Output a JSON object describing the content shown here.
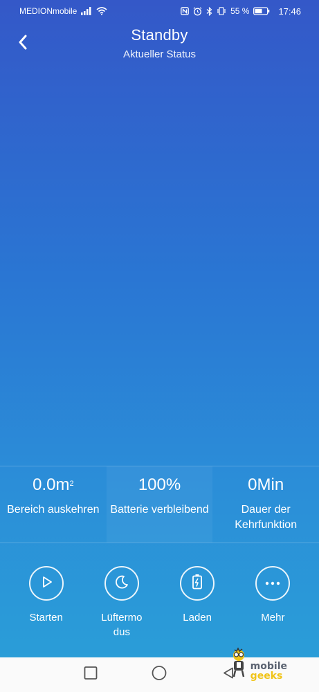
{
  "status_bar": {
    "carrier": "MEDIONmobile",
    "battery_percent": "55 %",
    "time": "17:46",
    "icons": [
      "signal-icon",
      "wifi-icon",
      "nfc-icon",
      "alarm-icon",
      "bluetooth-icon",
      "vibrate-icon",
      "battery-icon"
    ]
  },
  "header": {
    "title": "Standby",
    "subtitle": "Aktueller Status"
  },
  "stats": [
    {
      "value": "0.0m",
      "unit_sup": "2",
      "label": "Bereich auskehren"
    },
    {
      "value": "100%",
      "label": "Batterie verbleibend"
    },
    {
      "value": "0Min",
      "label": "Dauer der Kehrfunktion"
    }
  ],
  "actions": [
    {
      "label": "Starten",
      "icon": "play-icon"
    },
    {
      "label": "Lüftermo dus",
      "icon": "moon-icon"
    },
    {
      "label": "Laden",
      "icon": "charging-battery-icon"
    },
    {
      "label": "Mehr",
      "icon": "more-dots-icon"
    }
  ],
  "navbar": {
    "icons": [
      "recents-square-icon",
      "home-circle-icon",
      "back-triangle-icon"
    ]
  },
  "watermark": {
    "line1": "mobile",
    "line2": "geeks"
  },
  "colors": {
    "gradient_top": "#3458c8",
    "gradient_bottom": "#2aa0d8",
    "navbar_bg": "#fafafa"
  }
}
